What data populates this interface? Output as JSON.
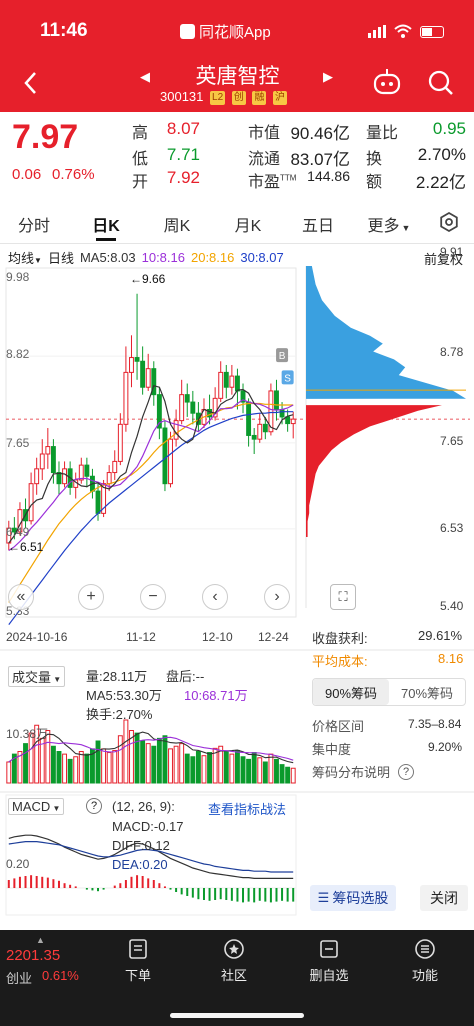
{
  "status_bar": {
    "time": "11:46",
    "app_name": "同花顺App"
  },
  "stock": {
    "name": "英唐智控",
    "code": "300131",
    "badges": [
      "L2",
      "创",
      "融",
      "沪"
    ]
  },
  "quote": {
    "price": "7.97",
    "change": "0.06",
    "change_pct": "0.76%",
    "fields": [
      {
        "label": "高",
        "value": "8.07",
        "color": "red"
      },
      {
        "label": "市值",
        "value": "90.46亿",
        "color": "black"
      },
      {
        "label": "量比",
        "value": "0.95",
        "color": "green"
      },
      {
        "label": "低",
        "value": "7.71",
        "color": "green"
      },
      {
        "label": "流通",
        "value": "83.07亿",
        "color": "black"
      },
      {
        "label": "换",
        "value": "2.70%",
        "color": "black"
      },
      {
        "label": "开",
        "value": "7.92",
        "color": "red"
      },
      {
        "label": "市盈",
        "sup": "TTM",
        "value": "144.86",
        "color": "black"
      },
      {
        "label": "额",
        "value": "2.22亿",
        "color": "black"
      }
    ]
  },
  "tabs": [
    "分时",
    "日K",
    "周K",
    "月K",
    "五日",
    "更多"
  ],
  "active_tab": "日K",
  "ma_row": {
    "type": "均线",
    "period": "日线",
    "ma5": "MA5:8.03",
    "ma10": "10:8.16",
    "ma20": "20:8.16",
    "ma30": "30:8.07",
    "adjust": "前复权"
  },
  "kline": {
    "y_labels": [
      "9.98",
      "8.82",
      "7.65",
      "6.49",
      "5.33"
    ],
    "high_mark": "←9.66",
    "low_mark": "←6.51",
    "dates": [
      "2024-10-16",
      "11-12",
      "12-10",
      "12-24"
    ],
    "markers": [
      "B",
      "S"
    ]
  },
  "chip": {
    "y_labels": [
      "9.91",
      "8.78",
      "7.65",
      "6.53",
      "5.40"
    ],
    "profit_label": "收盘获利:",
    "profit_value": "29.61%",
    "avg_label": "平均成本:",
    "avg_value": "8.16",
    "btn_90": "90%筹码",
    "btn_70": "70%筹码",
    "range_label": "价格区间",
    "range_value": "7.35–8.84",
    "conc_label": "集中度",
    "conc_value": "9.20%",
    "help_label": "筹码分布说明",
    "select_btn": "筹码选股",
    "close_btn": "关闭"
  },
  "volume": {
    "selector": "成交量",
    "vol": "量:28.11万",
    "after": "盘后:--",
    "ma5": "MA5:53.30万",
    "ma10": "10:68.71万",
    "turnover": "换手:2.70%",
    "axis_label": "10.38万"
  },
  "macd": {
    "selector": "MACD",
    "params": "(12, 26, 9):",
    "link": "查看指标战法",
    "macd": "MACD:-0.17",
    "diff": "DIFF:0.12",
    "dea": "DEA:0.20",
    "axis_label": "0.20"
  },
  "bottom": {
    "index_value": "2201.35",
    "index_name": "创业",
    "index_pct": "0.61%",
    "items": [
      {
        "label": "下单"
      },
      {
        "label": "社区"
      },
      {
        "label": "删自选"
      },
      {
        "label": "功能"
      }
    ]
  },
  "colors": {
    "red": "#e6202b",
    "green": "#0a9a2c",
    "ma5": "#333333",
    "ma10": "#9b30d9",
    "ma20": "#f2a400",
    "ma30": "#2040c8",
    "chip_blue": "#3aa0e0",
    "chip_red": "#e6202b"
  },
  "chart_data": {
    "type": "candlestick",
    "candles": [
      [
        6.3,
        6.5,
        6.2,
        6.6
      ],
      [
        6.5,
        6.45,
        6.35,
        6.65
      ],
      [
        6.45,
        6.75,
        6.4,
        6.85
      ],
      [
        6.75,
        6.6,
        6.5,
        6.9
      ],
      [
        6.6,
        7.1,
        6.55,
        7.25
      ],
      [
        7.1,
        7.3,
        6.95,
        7.45
      ],
      [
        7.3,
        7.5,
        7.15,
        7.7
      ],
      [
        7.5,
        7.6,
        7.3,
        7.85
      ],
      [
        7.6,
        7.25,
        7.1,
        7.7
      ],
      [
        7.25,
        7.1,
        6.95,
        7.4
      ],
      [
        7.1,
        7.3,
        7.05,
        7.4
      ],
      [
        7.3,
        7.05,
        6.95,
        7.4
      ],
      [
        7.05,
        7.15,
        6.9,
        7.25
      ],
      [
        7.15,
        7.35,
        7.1,
        7.45
      ],
      [
        7.35,
        7.2,
        7.05,
        7.45
      ],
      [
        7.2,
        7.0,
        6.9,
        7.3
      ],
      [
        7.0,
        6.7,
        6.6,
        7.1
      ],
      [
        6.7,
        7.1,
        6.65,
        7.15
      ],
      [
        7.1,
        7.25,
        7.0,
        7.35
      ],
      [
        7.25,
        7.4,
        7.15,
        7.55
      ],
      [
        7.4,
        7.9,
        7.35,
        8.05
      ],
      [
        7.9,
        8.6,
        7.8,
        8.95
      ],
      [
        8.6,
        8.8,
        8.4,
        9.1
      ],
      [
        8.8,
        8.75,
        8.5,
        9.66
      ],
      [
        8.75,
        8.4,
        8.3,
        8.95
      ],
      [
        8.4,
        8.65,
        8.35,
        8.85
      ],
      [
        8.65,
        8.3,
        8.15,
        8.75
      ],
      [
        8.3,
        7.85,
        7.7,
        8.4
      ],
      [
        7.85,
        7.1,
        7.0,
        7.95
      ],
      [
        7.1,
        7.7,
        7.05,
        7.8
      ],
      [
        7.7,
        7.95,
        7.6,
        8.1
      ],
      [
        7.95,
        8.3,
        7.9,
        8.5
      ],
      [
        8.3,
        8.2,
        8.0,
        8.45
      ],
      [
        8.2,
        8.05,
        7.9,
        8.35
      ],
      [
        8.05,
        7.9,
        7.8,
        8.2
      ],
      [
        7.9,
        8.1,
        7.85,
        8.25
      ],
      [
        8.1,
        8.0,
        7.9,
        8.3
      ],
      [
        8.0,
        8.25,
        7.95,
        8.4
      ],
      [
        8.25,
        8.6,
        8.2,
        8.75
      ],
      [
        8.6,
        8.4,
        8.25,
        8.7
      ],
      [
        8.4,
        8.55,
        8.3,
        8.7
      ],
      [
        8.55,
        8.35,
        8.1,
        8.65
      ],
      [
        8.35,
        8.2,
        8.05,
        8.45
      ],
      [
        8.2,
        7.75,
        7.6,
        8.25
      ],
      [
        7.75,
        7.7,
        7.5,
        7.85
      ],
      [
        7.7,
        7.9,
        7.65,
        8.05
      ],
      [
        7.9,
        7.8,
        7.7,
        8.0
      ],
      [
        7.8,
        8.35,
        7.75,
        8.45
      ],
      [
        8.35,
        8.1,
        7.95,
        8.5
      ],
      [
        8.1,
        8.0,
        7.9,
        8.2
      ],
      [
        8.0,
        7.91,
        7.8,
        8.1
      ],
      [
        7.91,
        7.97,
        7.71,
        8.07
      ]
    ],
    "ma5": [
      6.3,
      6.4,
      6.55,
      6.68,
      6.81,
      6.88,
      6.9,
      7.09,
      7.23,
      7.24,
      7.23,
      7.18,
      7.12,
      7.07,
      7.06,
      7.1,
      7.11,
      7.05,
      7.03,
      7.1,
      7.2,
      7.25,
      7.52,
      7.74,
      8.0,
      8.2,
      8.42,
      8.4,
      8.21,
      7.9,
      7.78,
      7.7,
      7.65,
      7.7,
      7.96,
      8.1,
      8.07,
      8.05,
      8.17,
      8.22,
      8.25,
      8.36,
      8.37,
      8.32,
      8.18,
      8.1,
      7.98,
      7.86,
      7.83,
      7.96,
      8.01,
      8.03
    ],
    "ma10": [
      6.2,
      6.25,
      6.32,
      6.4,
      6.5,
      6.58,
      6.67,
      6.76,
      6.85,
      6.95,
      7.03,
      7.12,
      7.16,
      7.17,
      7.17,
      7.14,
      7.12,
      7.09,
      7.06,
      7.07,
      7.09,
      7.16,
      7.24,
      7.33,
      7.47,
      7.64,
      7.81,
      7.92,
      7.95,
      7.92,
      7.9,
      7.88,
      7.86,
      7.83,
      7.8,
      7.87,
      7.95,
      8.04,
      8.11,
      8.11,
      8.12,
      8.18,
      8.23,
      8.2,
      8.18,
      8.17,
      8.14,
      8.1,
      8.09,
      8.1,
      8.12,
      8.16
    ],
    "ma20": [
      5.5,
      5.62,
      5.74,
      5.86,
      5.98,
      6.1,
      6.22,
      6.34,
      6.45,
      6.56,
      6.65,
      6.74,
      6.82,
      6.89,
      6.95,
      7.0,
      7.05,
      7.08,
      7.1,
      7.12,
      7.15,
      7.18,
      7.22,
      7.28,
      7.35,
      7.43,
      7.52,
      7.6,
      7.66,
      7.72,
      7.78,
      7.83,
      7.88,
      7.92,
      7.96,
      8.0,
      8.03,
      8.06,
      8.09,
      8.12,
      8.13,
      8.15,
      8.17,
      8.18,
      8.18,
      8.18,
      8.17,
      8.17,
      8.16,
      8.16,
      8.16,
      8.16
    ],
    "ma30": [
      5.2,
      5.3,
      5.4,
      5.5,
      5.6,
      5.7,
      5.8,
      5.9,
      6.0,
      6.1,
      6.2,
      6.29,
      6.38,
      6.47,
      6.55,
      6.63,
      6.7,
      6.77,
      6.84,
      6.9,
      6.96,
      7.02,
      7.08,
      7.14,
      7.2,
      7.26,
      7.32,
      7.38,
      7.44,
      7.5,
      7.56,
      7.62,
      7.67,
      7.72,
      7.77,
      7.82,
      7.86,
      7.89,
      7.92,
      7.95,
      7.98,
      8.0,
      8.02,
      8.03,
      8.04,
      8.05,
      8.05,
      8.06,
      8.06,
      8.07,
      8.07,
      8.07
    ],
    "volume": [
      40,
      55,
      60,
      75,
      95,
      110,
      85,
      100,
      70,
      60,
      55,
      45,
      50,
      60,
      55,
      65,
      80,
      65,
      58,
      62,
      90,
      120,
      100,
      95,
      80,
      75,
      70,
      85,
      90,
      65,
      70,
      75,
      55,
      50,
      60,
      52,
      58,
      66,
      70,
      60,
      55,
      62,
      50,
      45,
      58,
      48,
      40,
      55,
      45,
      35,
      30,
      28.11
    ],
    "macd_hist": [
      0.1,
      0.12,
      0.14,
      0.15,
      0.16,
      0.15,
      0.14,
      0.13,
      0.11,
      0.09,
      0.06,
      0.04,
      0.02,
      0.0,
      -0.02,
      -0.03,
      -0.04,
      -0.02,
      0.0,
      0.03,
      0.06,
      0.1,
      0.14,
      0.16,
      0.15,
      0.12,
      0.1,
      0.06,
      0.02,
      -0.02,
      -0.05,
      -0.08,
      -0.1,
      -0.12,
      -0.14,
      -0.15,
      -0.16,
      -0.15,
      -0.14,
      -0.15,
      -0.16,
      -0.17,
      -0.18,
      -0.17,
      -0.18,
      -0.16,
      -0.17,
      -0.18,
      -0.17,
      -0.16,
      -0.17,
      -0.17
    ],
    "diff": [
      0.62,
      0.64,
      0.65,
      0.66,
      0.66,
      0.65,
      0.63,
      0.61,
      0.58,
      0.55,
      0.51,
      0.48,
      0.45,
      0.42,
      0.4,
      0.38,
      0.36,
      0.37,
      0.39,
      0.42,
      0.46,
      0.5,
      0.54,
      0.56,
      0.55,
      0.52,
      0.49,
      0.45,
      0.41,
      0.37,
      0.34,
      0.31,
      0.28,
      0.25,
      0.23,
      0.21,
      0.19,
      0.18,
      0.17,
      0.16,
      0.15,
      0.14,
      0.13,
      0.13,
      0.12,
      0.12,
      0.12,
      0.12,
      0.12,
      0.12,
      0.12,
      0.12
    ],
    "dea": [
      0.55,
      0.56,
      0.57,
      0.58,
      0.58,
      0.58,
      0.57,
      0.56,
      0.55,
      0.54,
      0.52,
      0.5,
      0.48,
      0.46,
      0.44,
      0.42,
      0.4,
      0.39,
      0.39,
      0.4,
      0.41,
      0.43,
      0.45,
      0.47,
      0.48,
      0.48,
      0.47,
      0.46,
      0.44,
      0.42,
      0.4,
      0.38,
      0.36,
      0.34,
      0.32,
      0.3,
      0.29,
      0.27,
      0.26,
      0.25,
      0.24,
      0.23,
      0.22,
      0.22,
      0.21,
      0.21,
      0.21,
      0.2,
      0.2,
      0.2,
      0.2,
      0.2
    ],
    "chip_levels": [
      [
        9.91,
        0.02,
        "b"
      ],
      [
        9.7,
        0.04,
        "b"
      ],
      [
        9.5,
        0.06,
        "b"
      ],
      [
        9.3,
        0.1,
        "b"
      ],
      [
        9.1,
        0.18,
        "b"
      ],
      [
        8.95,
        0.28,
        "b"
      ],
      [
        8.85,
        0.4,
        "b"
      ],
      [
        8.75,
        0.48,
        "b"
      ],
      [
        8.65,
        0.42,
        "b"
      ],
      [
        8.55,
        0.55,
        "b"
      ],
      [
        8.45,
        0.62,
        "b"
      ],
      [
        8.35,
        0.58,
        "b"
      ],
      [
        8.25,
        0.75,
        "b"
      ],
      [
        8.15,
        0.92,
        "b"
      ],
      [
        8.05,
        1.0,
        "b"
      ],
      [
        7.97,
        0.85,
        "r"
      ],
      [
        7.9,
        0.7,
        "r"
      ],
      [
        7.8,
        0.55,
        "r"
      ],
      [
        7.7,
        0.4,
        "r"
      ],
      [
        7.6,
        0.3,
        "r"
      ],
      [
        7.5,
        0.22,
        "r"
      ],
      [
        7.4,
        0.16,
        "r"
      ],
      [
        7.3,
        0.12,
        "r"
      ],
      [
        7.2,
        0.08,
        "r"
      ],
      [
        7.1,
        0.06,
        "r"
      ],
      [
        7.0,
        0.05,
        "r"
      ],
      [
        6.9,
        0.04,
        "r"
      ],
      [
        6.8,
        0.03,
        "r"
      ],
      [
        6.7,
        0.02,
        "r"
      ],
      [
        6.6,
        0.02,
        "r"
      ],
      [
        6.5,
        0.01,
        "r"
      ],
      [
        6.4,
        0.01,
        "r"
      ],
      [
        6.3,
        0.01,
        "r"
      ]
    ]
  }
}
